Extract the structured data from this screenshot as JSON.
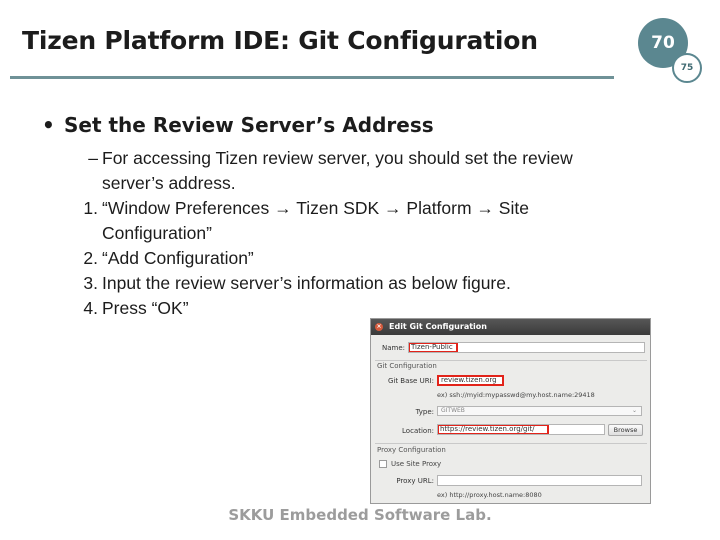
{
  "slide": {
    "title": "Tizen Platform IDE: Git Configuration",
    "page_number": "70",
    "page_total": "75",
    "bullet": "Set the Review Server’s Address",
    "bullet_marker": "•",
    "sub_marker": "–",
    "sub_text": "For accessing Tizen review server, you should set the review server’s address.",
    "steps": [
      {
        "marker": "1.",
        "text": "“Window Preferences → Tizen SDK → Platform → Site Configuration”"
      },
      {
        "marker": "2.",
        "text": "“Add Configuration”"
      },
      {
        "marker": "3.",
        "text": "Input the review server’s information as below figure."
      },
      {
        "marker": "4.",
        "text": "Press “OK”"
      }
    ],
    "footer": "SKKU Embedded Software Lab."
  },
  "dialog": {
    "title": "Edit Git Configuration",
    "close_glyph": "×",
    "name_label": "Name:",
    "name_value": "Tizen-Public",
    "git_section": "Git Configuration",
    "base_uri_label": "Git Base URI:",
    "base_uri_value": "review.tizen.org",
    "base_uri_hint": "ex) ssh://myid:mypasswd@my.host.name:29418",
    "type_label": "Type:",
    "type_value": "GITWEB",
    "type_arrow": "⌄",
    "location_label": "Location:",
    "location_value": "https://review.tizen.org/git/",
    "browse_label": "Browse",
    "proxy_section": "Proxy Configuration",
    "use_site_proxy_label": "Use Site Proxy",
    "proxy_url_label": "Proxy URL:",
    "proxy_url_value": "",
    "proxy_url_hint": "ex) http://proxy.host.name:8080"
  }
}
